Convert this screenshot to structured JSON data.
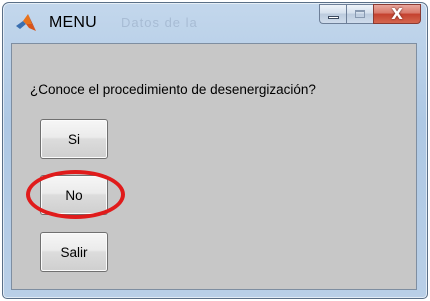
{
  "window": {
    "title": "MENU",
    "title_ghost": "Datos de la",
    "icon": "matlab-icon",
    "controls": {
      "minimize": "minimize-icon",
      "maximize": "maximize-icon",
      "close": "close-icon",
      "close_glyph": "X"
    }
  },
  "dialog": {
    "question": "¿Conoce el procedimiento de desenergización?",
    "buttons": {
      "yes_label": "Si",
      "no_label": "No",
      "exit_label": "Salir"
    }
  },
  "annotation": {
    "highlight_color": "#e01b1b",
    "highlight_target": "No"
  },
  "colors": {
    "client_background": "#c7c7c7",
    "titlebar": "#b9cfe7"
  }
}
